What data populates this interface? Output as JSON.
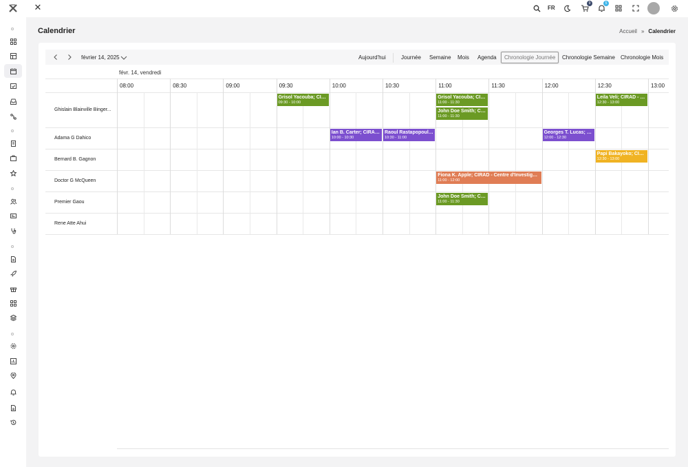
{
  "header": {
    "lang": "FR",
    "cart_badge": "9",
    "bell_badge": "5"
  },
  "page": {
    "title": "Calendrier",
    "breadcrumb": [
      "Accueil",
      "»",
      "Calendrier"
    ]
  },
  "toolbar": {
    "date": "février 14, 2025",
    "today": "Aujourd'hui",
    "views": [
      "Journée",
      "Semaine",
      "Mois",
      "Agenda",
      "Chronologie Journée",
      "Chronologie Semaine",
      "Chronologie Mois"
    ],
    "active_view": "Chronologie Journée"
  },
  "timeline": {
    "day_label": "févr. 14, vendredi",
    "times": [
      "08:00",
      "08:30",
      "09:00",
      "09:30",
      "10:00",
      "10:30",
      "11:00",
      "11:30",
      "12:00",
      "12:30",
      "13:00"
    ],
    "resources": [
      "Ghislain Blainville Binger...",
      "Adama G Dahico",
      "Bernard B. Gagnon",
      "Doctor G McQueen",
      "Premier Gaou",
      "Rene Atte Ahui"
    ],
    "events": [
      {
        "title": "Grisol Yacouba; CIR...",
        "time": "09:30 - 10:00",
        "color": "green",
        "res": 0,
        "slot": 0
      },
      {
        "title": "Grisol Yacouba; CIR...",
        "time": "11:00 - 11:30",
        "color": "green",
        "res": 0,
        "slot": 0
      },
      {
        "title": "John Doe Smith; CIR...",
        "time": "11:00 - 11:30",
        "color": "green",
        "res": 0,
        "slot": 1
      },
      {
        "title": "Leila Veli; CIRAD - C...",
        "time": "12:30 - 13:00",
        "color": "green",
        "res": 0,
        "slot": 0
      },
      {
        "title": "Ian B. Carter; CIRAD...",
        "time": "10:00 - 10:30",
        "color": "purple",
        "res": 1,
        "slot": 0
      },
      {
        "title": "Raoul Rastapopoulo...",
        "time": "10:30 - 11:00",
        "color": "purple",
        "res": 1,
        "slot": 0
      },
      {
        "title": "Georges T. Lucas; C...",
        "time": "12:00 - 12:30",
        "color": "purple",
        "res": 1,
        "slot": 0
      },
      {
        "title": "Papi Bakayoko; CIR...",
        "time": "12:30 - 13:00",
        "color": "yellow",
        "res": 2,
        "slot": 0
      },
      {
        "title": "Fiona K. Apple; CIRAD - Centre d'Investigati...",
        "time": "11:00 - 12:00",
        "color": "orange",
        "res": 3,
        "slot": 0
      },
      {
        "title": "John Doe Smith; CIR...",
        "time": "11:00 - 11:30",
        "color": "green",
        "res": 4,
        "slot": 0
      }
    ]
  },
  "colors": {
    "green": "#6b9a24",
    "purple": "#7c4fcf",
    "orange": "#e07d55",
    "yellow": "#f0b323"
  }
}
